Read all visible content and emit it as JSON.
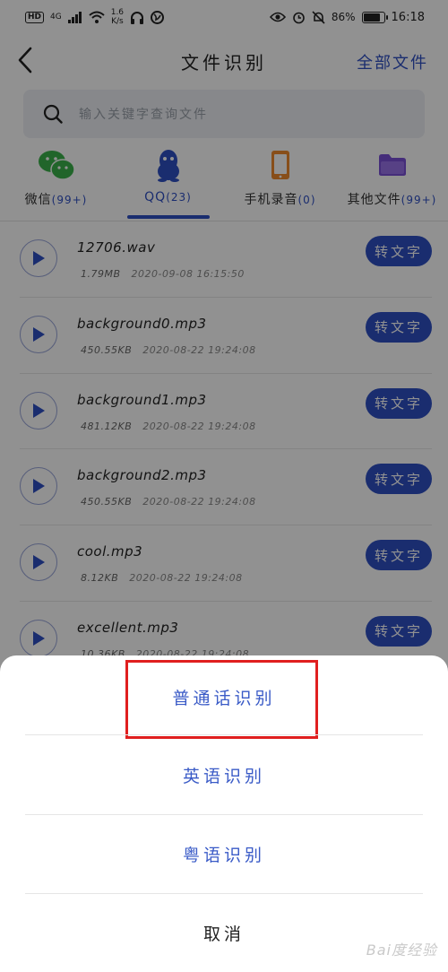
{
  "status_bar": {
    "network_badge": "HD",
    "signal_tag": "4G",
    "speed_value": "1.6",
    "speed_unit": "K/s",
    "battery": "86%",
    "battery_level": 0.86,
    "time": "16:18"
  },
  "header": {
    "title": "文件识别",
    "right_link": "全部文件"
  },
  "search": {
    "placeholder": "输入关键字查询文件"
  },
  "tabs": [
    {
      "label": "微信",
      "count": "(99+)",
      "icon": "wechat-icon",
      "active": false
    },
    {
      "label": "QQ",
      "count": "(23)",
      "icon": "qq-penguin-icon",
      "active": true
    },
    {
      "label": "手机录音",
      "count": "(0)",
      "icon": "phone-icon",
      "active": false
    },
    {
      "label": "其他文件",
      "count": "(99+)",
      "icon": "folder-icon",
      "active": false
    }
  ],
  "files": [
    {
      "name": "12706.wav",
      "size": "1.79MB",
      "date": "2020-09-08 16:15:50",
      "action": "转文字"
    },
    {
      "name": "background0.mp3",
      "size": "450.55KB",
      "date": "2020-08-22 19:24:08",
      "action": "转文字"
    },
    {
      "name": "background1.mp3",
      "size": "481.12KB",
      "date": "2020-08-22 19:24:08",
      "action": "转文字"
    },
    {
      "name": "background2.mp3",
      "size": "450.55KB",
      "date": "2020-08-22 19:24:08",
      "action": "转文字"
    },
    {
      "name": "cool.mp3",
      "size": "8.12KB",
      "date": "2020-08-22 19:24:08",
      "action": "转文字"
    },
    {
      "name": "excellent.mp3",
      "size": "10.36KB",
      "date": "2020-08-22 19:24:08",
      "action": "转文字"
    }
  ],
  "sheet": {
    "options": [
      "普通话识别",
      "英语识别",
      "粤语识别"
    ],
    "cancel": "取消"
  },
  "watermark": "Bai度经验",
  "colors": {
    "accent": "#2f4fc4",
    "highlight": "#e01f1f",
    "wechat": "#3bb24a",
    "qq": "#2f4fc4",
    "phone": "#f08a2c",
    "folder": "#7a4fd6"
  }
}
